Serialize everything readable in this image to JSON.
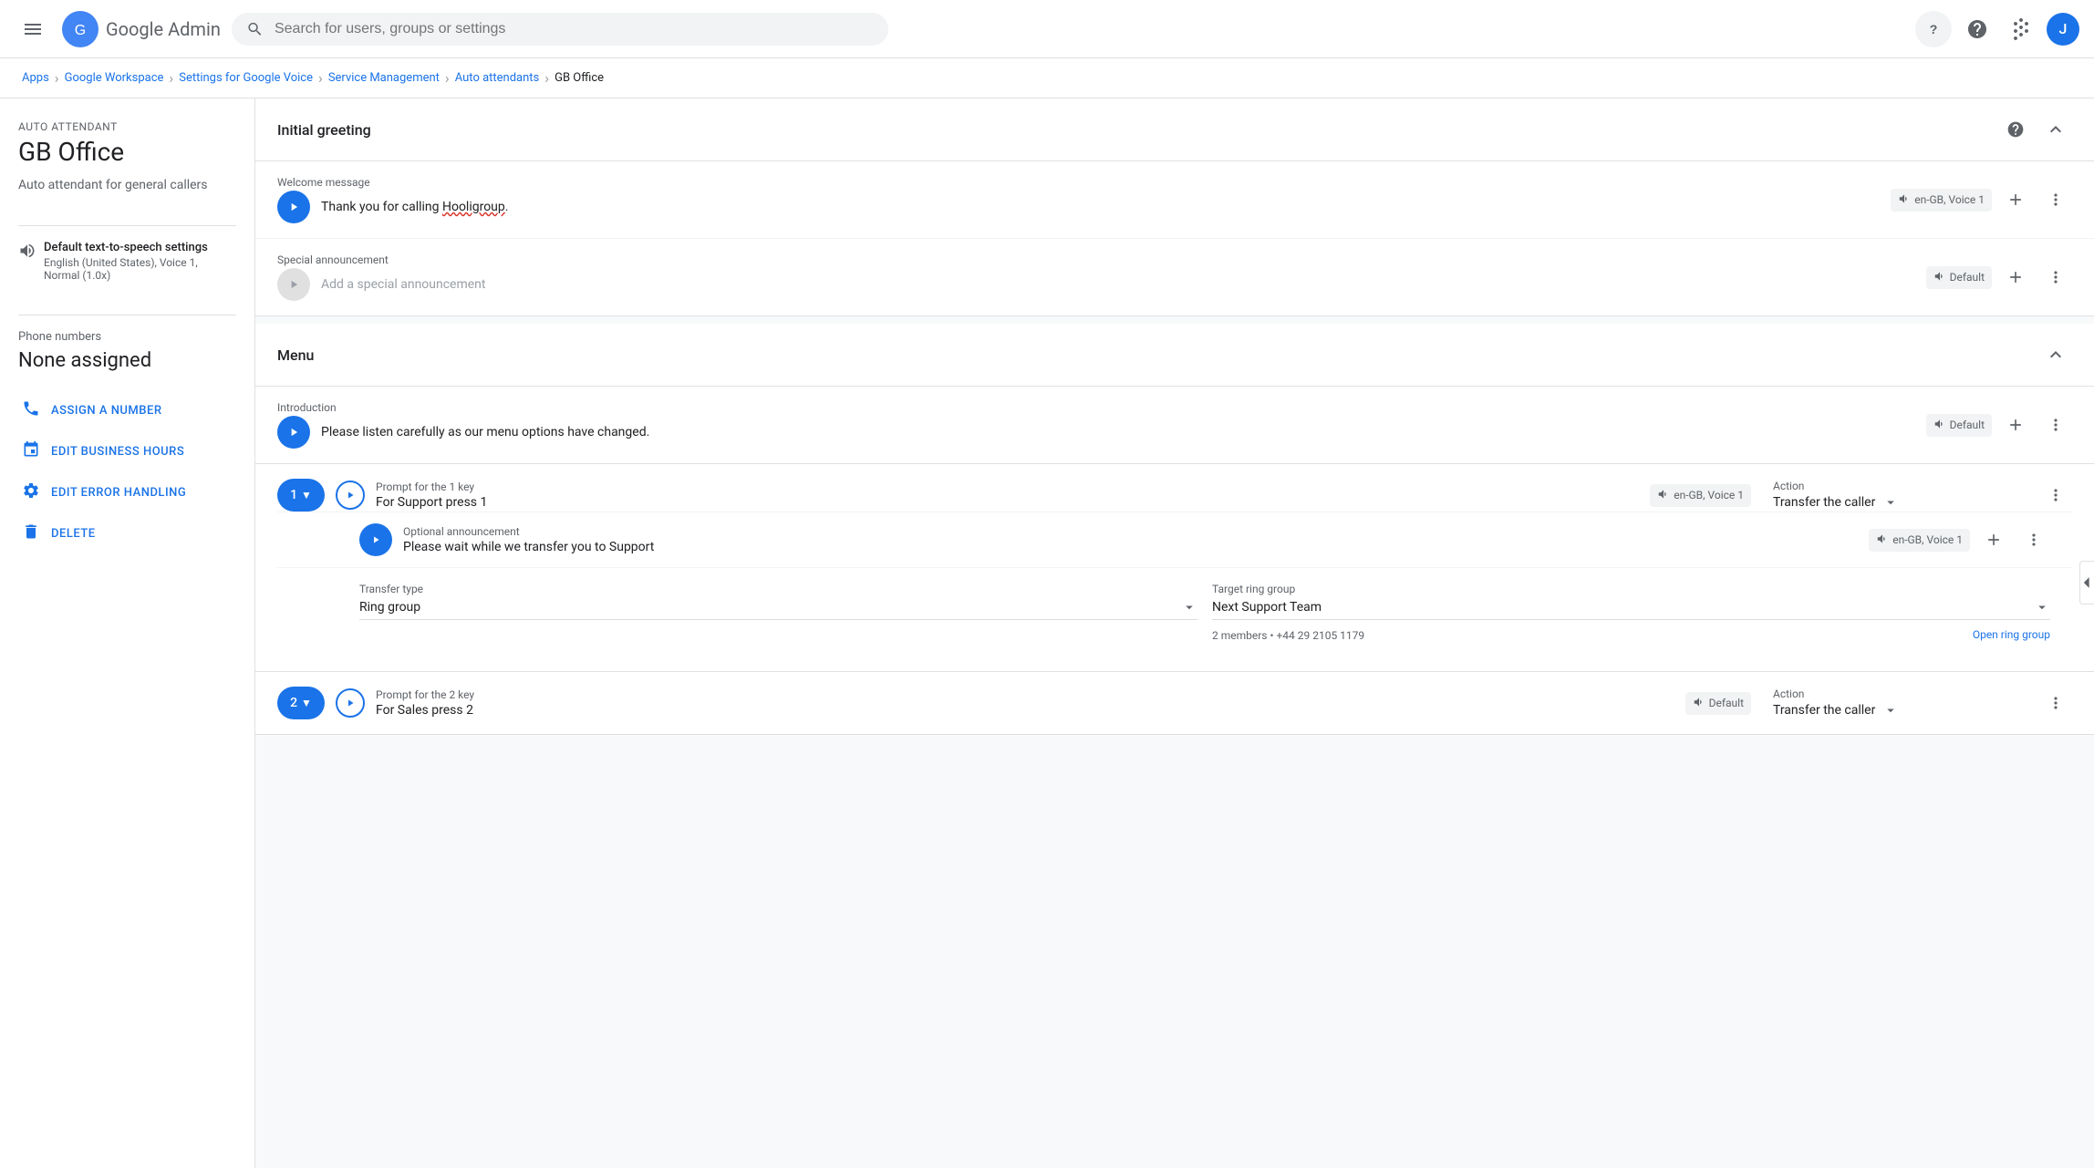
{
  "topNav": {
    "appName": "Google Admin",
    "searchPlaceholder": "Search for users, groups or settings",
    "helpCircleLabel": "?",
    "helpIcon": "help-icon",
    "appsIcon": "apps-icon",
    "avatarLetter": "J"
  },
  "breadcrumb": {
    "items": [
      {
        "label": "Apps",
        "href": "#"
      },
      {
        "label": "Google Workspace",
        "href": "#"
      },
      {
        "label": "Settings for Google Voice",
        "href": "#"
      },
      {
        "label": "Service Management",
        "href": "#"
      },
      {
        "label": "Auto attendants",
        "href": "#"
      },
      {
        "label": "GB Office",
        "current": true
      }
    ]
  },
  "sidebar": {
    "autoAttendantLabel": "Auto attendant",
    "title": "GB Office",
    "subtitle": "Auto attendant for general callers",
    "tts": {
      "label": "Default text-to-speech settings",
      "value": "English (United States), Voice 1, Normal (1.0x)"
    },
    "phoneNumbers": {
      "sectionLabel": "Phone numbers",
      "value": "None assigned"
    },
    "actions": [
      {
        "id": "assign-number",
        "icon": "phone-icon",
        "label": "ASSIGN A NUMBER"
      },
      {
        "id": "edit-business-hours",
        "icon": "calendar-icon",
        "label": "EDIT BUSINESS HOURS"
      },
      {
        "id": "edit-error-handling",
        "icon": "error-handling-icon",
        "label": "EDIT ERROR HANDLING"
      },
      {
        "id": "delete",
        "icon": "delete-icon",
        "label": "DELETE"
      }
    ]
  },
  "initialGreeting": {
    "title": "Initial greeting",
    "welcomeMessage": {
      "label": "Welcome message",
      "text": "Thank you for calling Hooligroup.",
      "voice": "en-GB, Voice 1"
    },
    "specialAnnouncement": {
      "label": "Special announcement",
      "placeholder": "Add a special announcement",
      "voice": "Default"
    }
  },
  "menu": {
    "title": "Menu",
    "introduction": {
      "label": "Introduction",
      "text": "Please listen carefully as our menu options have changed.",
      "voice": "Default"
    },
    "keys": [
      {
        "keyNumber": "1",
        "promptLabel": "Prompt for the 1 key",
        "promptText": "For Support press 1",
        "voice": "en-GB, Voice 1",
        "actionLabel": "Action",
        "actionText": "Transfer the caller",
        "optionalAnnouncement": {
          "label": "Optional announcement",
          "text": "Please wait while we transfer you to Support",
          "voice": "en-GB, Voice 1"
        },
        "transferType": {
          "label": "Transfer type",
          "value": "Ring group"
        },
        "targetRingGroup": {
          "label": "Target ring group",
          "value": "Next Support Team",
          "sub": "2 members • +44 29 2105 1179",
          "link": "Open ring group"
        }
      },
      {
        "keyNumber": "2",
        "promptLabel": "Prompt for the 2 key",
        "promptText": "For Sales press 2",
        "voice": "Default",
        "actionLabel": "Action",
        "actionText": "Transfer the caller"
      }
    ]
  },
  "icons": {
    "menu": "☰",
    "search": "🔍",
    "help": "❓",
    "apps": "⋮⋮⋮",
    "chevronRight": "›",
    "chevronUp": "∧",
    "chevronDown": "∨",
    "play": "▶",
    "more": "⋮",
    "plus": "+",
    "phone": "📞",
    "calendar": "📅",
    "errorHandling": "⚙",
    "delete": "🗑",
    "tts": "🔊",
    "voice": "🔊"
  }
}
